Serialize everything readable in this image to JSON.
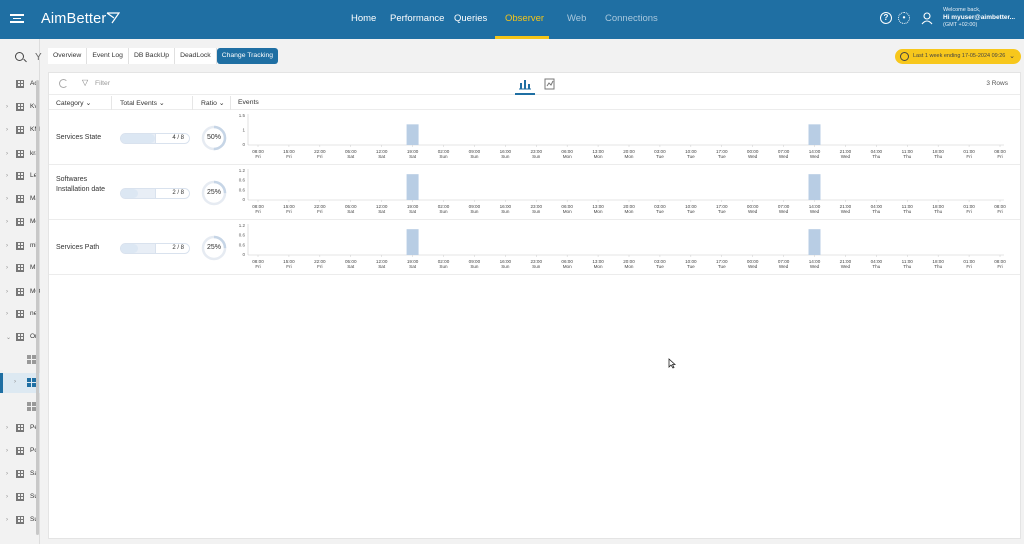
{
  "header": {
    "app_name": "AimBetter",
    "nav": [
      "Home",
      "Performance",
      "Queries",
      "Observer",
      "Web",
      "Connections"
    ],
    "active_nav": "Observer",
    "welcome_line": "Welcome back,",
    "user_line": "Hi myuser@aimbetter...",
    "timezone_line": "(GMT +02:00)",
    "help_icon": "question-circle-icon",
    "settings_icon": "gear-icon"
  },
  "sidebar": {
    "items": [
      {
        "label": "Ac",
        "icon": "grid-icon"
      },
      {
        "label": "Kv",
        "icon": "grid-icon"
      },
      {
        "label": "KM",
        "icon": "grid-icon"
      },
      {
        "label": "kra",
        "icon": "grid-icon"
      },
      {
        "label": "Le",
        "icon": "grid-icon"
      },
      {
        "label": "Ma",
        "icon": "grid-icon"
      },
      {
        "label": "Me",
        "icon": "grid-icon"
      },
      {
        "label": "mi",
        "icon": "grid-icon"
      },
      {
        "label": "MI",
        "icon": "grid-icon"
      },
      {
        "label": "MO",
        "icon": "grid-icon"
      },
      {
        "label": "ne",
        "icon": "grid-icon"
      },
      {
        "label": "Or",
        "icon": "grid-icon"
      },
      {
        "label": "",
        "icon": "windows-icon"
      },
      {
        "label": "",
        "icon": "windows-icon"
      },
      {
        "label": "",
        "icon": "windows-icon"
      },
      {
        "label": "Pe",
        "icon": "grid-icon"
      },
      {
        "label": "Po",
        "icon": "grid-icon"
      },
      {
        "label": "Sa",
        "icon": "grid-icon"
      },
      {
        "label": "Su",
        "icon": "grid-icon"
      },
      {
        "label": "Su",
        "icon": "grid-icon"
      }
    ]
  },
  "subtabs": [
    "Overview",
    "Event Log",
    "DB BackUp",
    "DeadLock",
    "Change Tracking"
  ],
  "active_subtab": "Change Tracking",
  "time_range": "Last 1 week ending  17-05-2024 09:26",
  "toolbar": {
    "filter_label": "Filter",
    "rows_count": "3 Rows"
  },
  "columns": {
    "category": "Category",
    "total_events": "Total Events",
    "ratio": "Ratio",
    "events": "Events"
  },
  "rows": [
    {
      "category": "Services State",
      "count": "4 / 8",
      "fraction": 0.5,
      "ratio": "50%",
      "yticks": [
        "1.5",
        "1",
        "0"
      ],
      "ymax": 1.5
    },
    {
      "category": "Softwares Installation date",
      "count": "2 / 8",
      "fraction": 0.25,
      "ratio": "25%",
      "yticks": [
        "1.2",
        "0.6",
        "0.6",
        "0"
      ],
      "ymax": 1.2
    },
    {
      "category": "Services Path",
      "count": "2 / 8",
      "fraction": 0.25,
      "ratio": "25%",
      "yticks": [
        "1.2",
        "0.6",
        "0.6",
        "0"
      ],
      "ymax": 1.2
    }
  ],
  "chart_data": {
    "type": "bar",
    "categories": [
      [
        "08:00",
        "Fri"
      ],
      [
        "15:00",
        "Fri"
      ],
      [
        "22:00",
        "Fri"
      ],
      [
        "05:00",
        "Sat"
      ],
      [
        "12:00",
        "Sat"
      ],
      [
        "19:00",
        "Sat"
      ],
      [
        "02:00",
        "Sun"
      ],
      [
        "09:00",
        "Sun"
      ],
      [
        "16:00",
        "Sun"
      ],
      [
        "23:00",
        "Sun"
      ],
      [
        "06:00",
        "Mon"
      ],
      [
        "13:00",
        "Mon"
      ],
      [
        "20:00",
        "Mon"
      ],
      [
        "03:00",
        "Tue"
      ],
      [
        "10:00",
        "Tue"
      ],
      [
        "17:00",
        "Tue"
      ],
      [
        "00:00",
        "Wed"
      ],
      [
        "07:00",
        "Wed"
      ],
      [
        "14:00",
        "Wed"
      ],
      [
        "21:00",
        "Wed"
      ],
      [
        "04:00",
        "Thu"
      ],
      [
        "11:00",
        "Thu"
      ],
      [
        "18:00",
        "Thu"
      ],
      [
        "01:00",
        "Fri"
      ],
      [
        "08:00",
        "Fri"
      ]
    ],
    "series": [
      {
        "values": [
          0,
          0,
          0,
          0,
          0,
          1,
          0,
          0,
          0,
          0,
          0,
          0,
          0,
          0,
          0,
          0,
          0,
          0,
          1,
          0,
          0,
          0,
          0,
          0,
          0
        ]
      },
      {
        "values": [
          0,
          0,
          0,
          0,
          0,
          1,
          0,
          0,
          0,
          0,
          0,
          0,
          0,
          0,
          0,
          0,
          0,
          0,
          1,
          0,
          0,
          0,
          0,
          0,
          0
        ]
      },
      {
        "values": [
          0,
          0,
          0,
          0,
          0,
          1,
          0,
          0,
          0,
          0,
          0,
          0,
          0,
          0,
          0,
          0,
          0,
          0,
          1,
          0,
          0,
          0,
          0,
          0,
          0
        ]
      }
    ],
    "bar_color": "#b8cde4"
  },
  "colors": {
    "brand": "#1f6fa3",
    "active_nav": "#f5c518",
    "time_button": "#f7c71c"
  }
}
